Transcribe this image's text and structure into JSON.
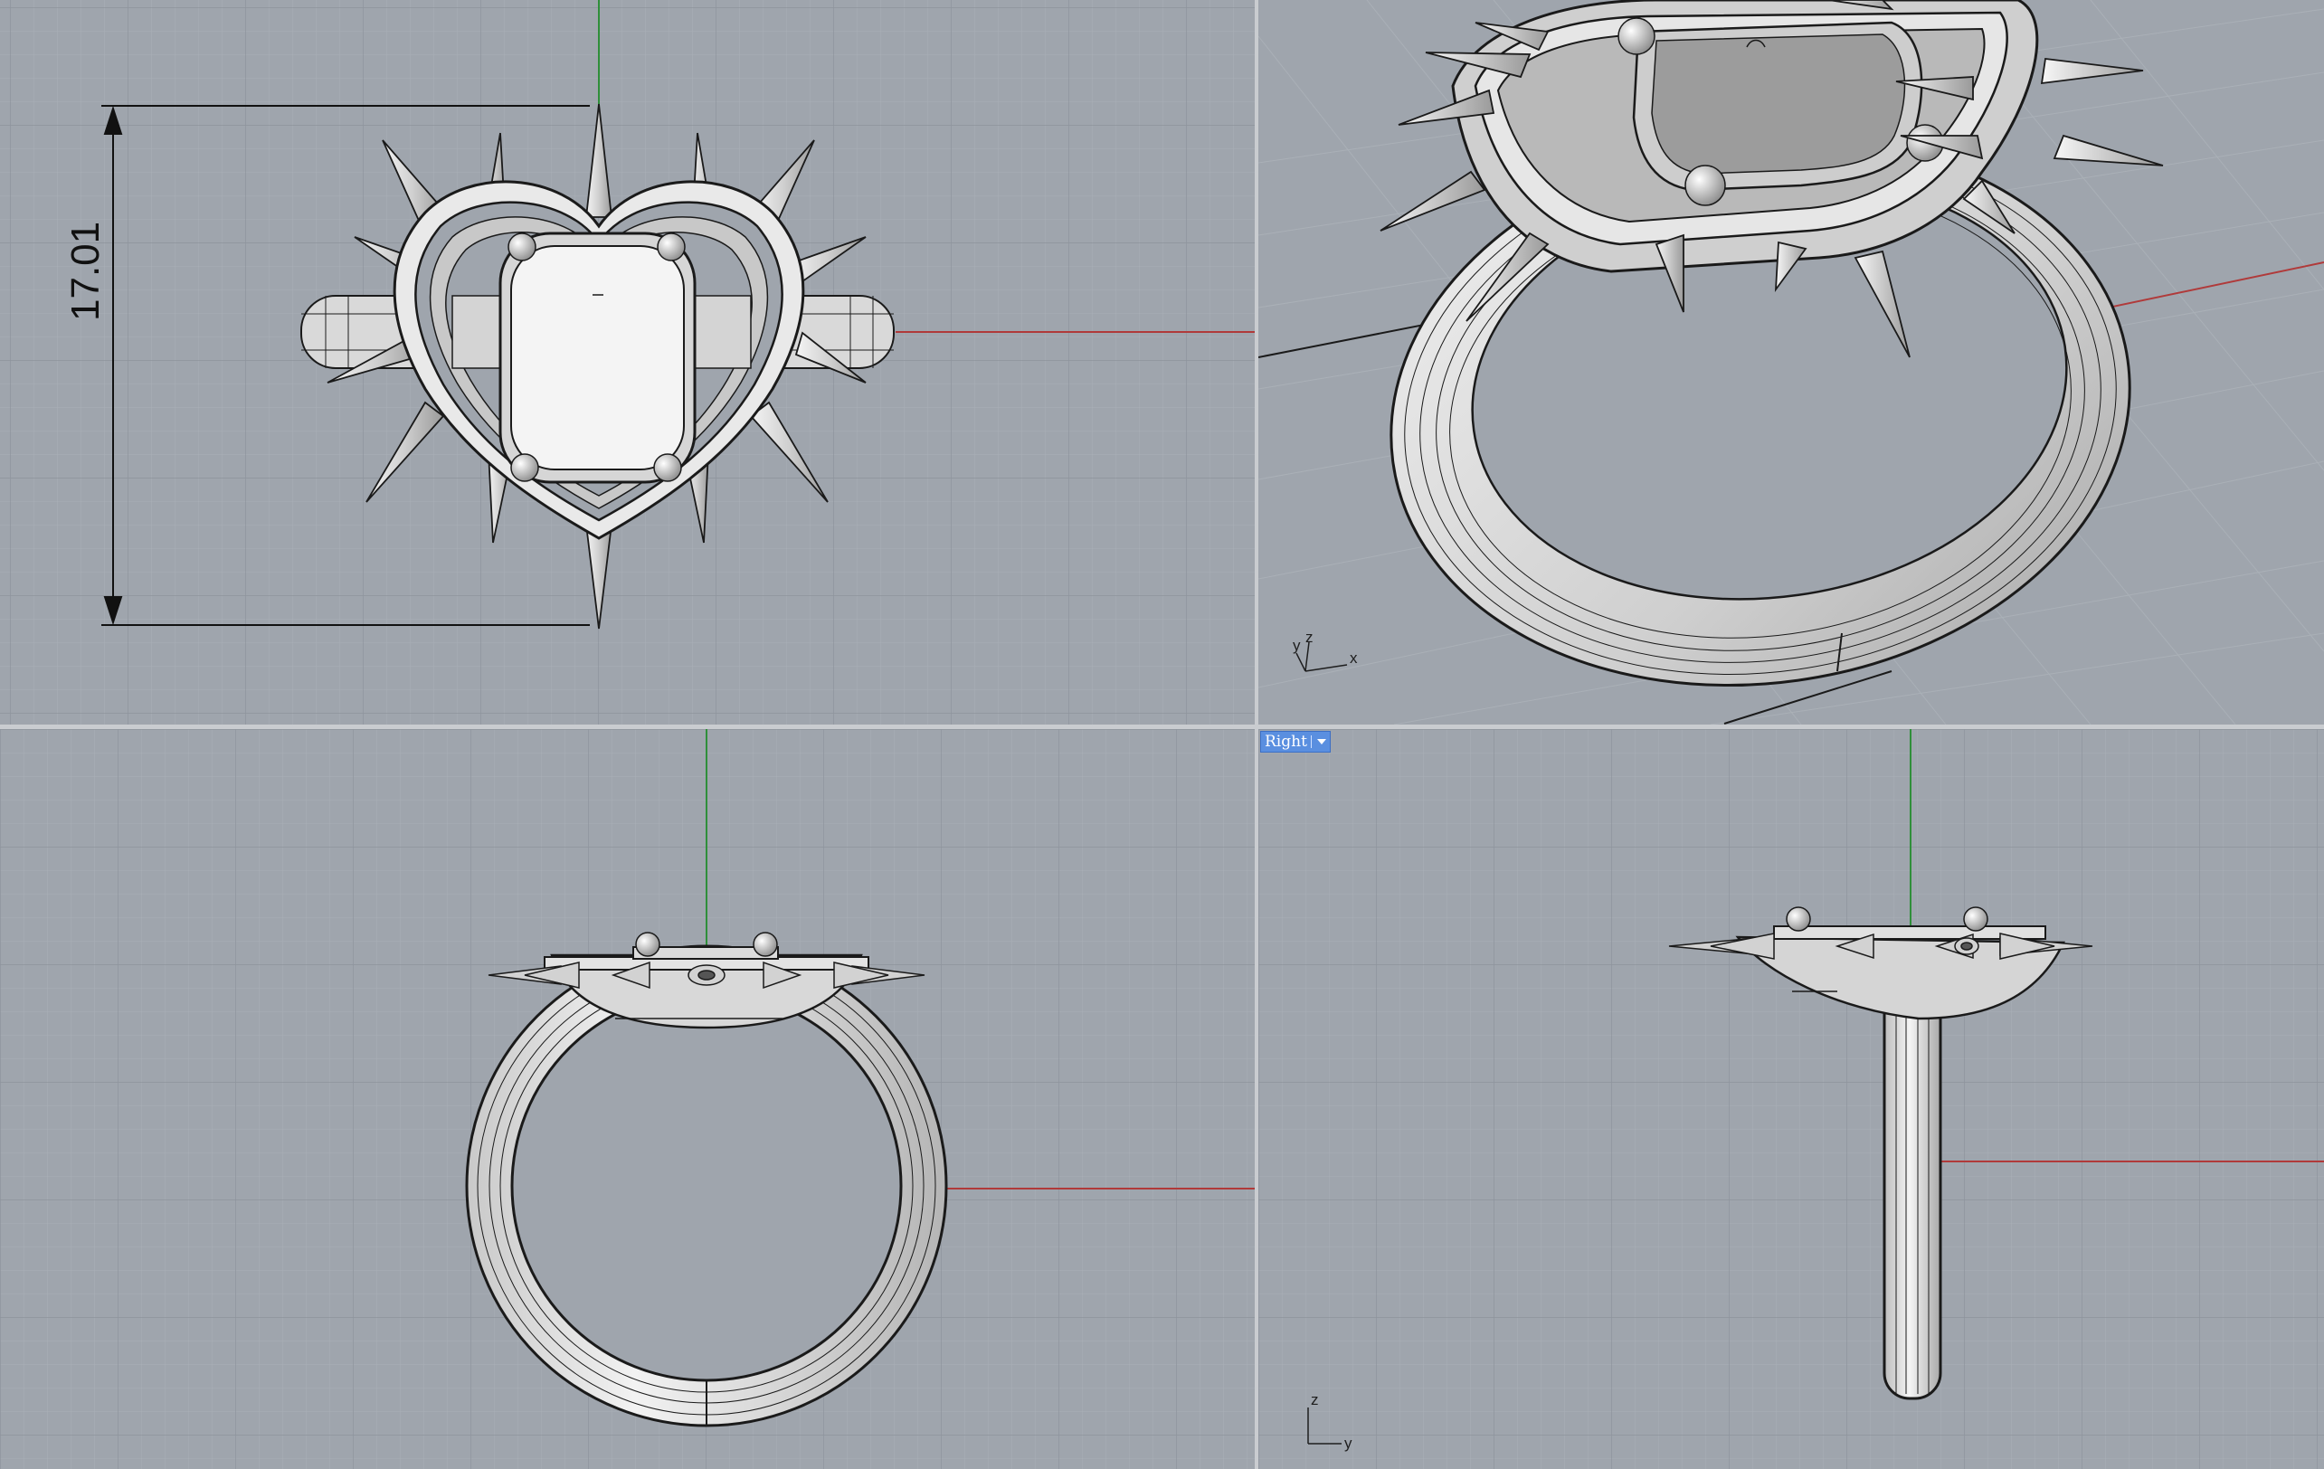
{
  "viewports": {
    "top": {
      "dimension_value": "17.01"
    },
    "perspective": {
      "axis_y": "y",
      "axis_z": "z",
      "axis_x": "x"
    },
    "front": {},
    "right": {
      "label": "Right",
      "axis_z": "z",
      "axis_y": "y"
    }
  },
  "colors": {
    "background": "#9fa5ad",
    "grid_minor": "#a9aeb5",
    "grid_major": "#8f959d",
    "axis_x": "#b03a3a",
    "axis_y": "#2f8f3a",
    "model_fill": "#e6e6e6",
    "model_stroke": "#1a1a1a",
    "label_bg": "#5a8fe0"
  }
}
